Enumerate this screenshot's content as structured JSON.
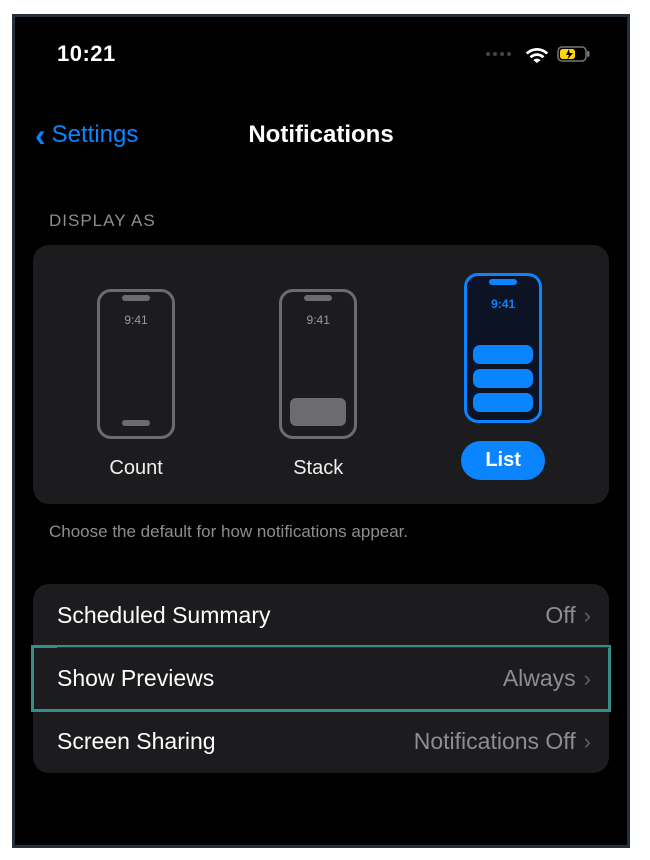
{
  "status": {
    "time": "10:21"
  },
  "nav": {
    "back_label": "Settings",
    "title": "Notifications"
  },
  "display_as": {
    "header": "DISPLAY AS",
    "phone_time": "9:41",
    "options": {
      "count": "Count",
      "stack": "Stack",
      "list": "List"
    },
    "footer": "Choose the default for how notifications appear."
  },
  "rows": {
    "scheduled_summary": {
      "label": "Scheduled Summary",
      "value": "Off"
    },
    "show_previews": {
      "label": "Show Previews",
      "value": "Always"
    },
    "screen_sharing": {
      "label": "Screen Sharing",
      "value": "Notifications Off"
    }
  }
}
